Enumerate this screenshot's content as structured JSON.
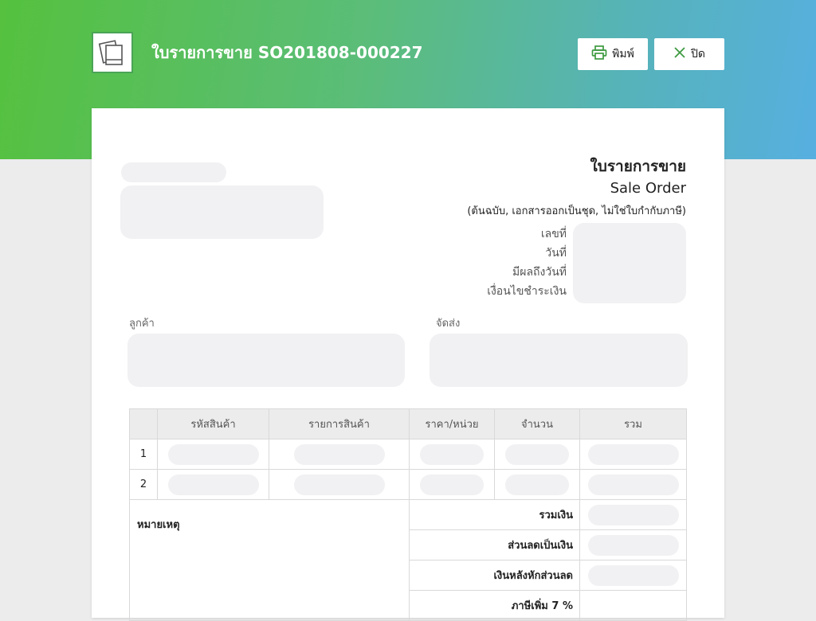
{
  "header": {
    "title": "ใบรายการขาย SO201808-000227",
    "icon": "photo-stack-icon",
    "print_label": "พิมพ์",
    "close_label": "ปิด",
    "colors": {
      "gradient_start": "#55c13e",
      "gradient_end": "#56afe0"
    }
  },
  "document": {
    "type_th": "ใบรายการขาย",
    "type_en": "Sale Order",
    "note": "(ต้นฉบับ, เอกสารออกเป็นชุด, ไม่ใช่ใบกำกับภาษี)",
    "meta_labels": [
      "เลขที่",
      "วันที่",
      "มีผลถึงวันที่",
      "เงื่อนไขชำระเงิน"
    ],
    "customer_label": "ลูกค้า",
    "shipping_label": "จัดส่ง"
  },
  "table": {
    "columns": [
      "",
      "รหัสสินค้า",
      "รายการสินค้า",
      "ราคา/หน่วย",
      "จำนวน",
      "รวม"
    ],
    "rows": [
      {
        "no": "1"
      },
      {
        "no": "2"
      }
    ],
    "remark_label": "หมายเหตุ",
    "summary_labels": [
      "รวมเงิน",
      "ส่วนลดเป็นเงิน",
      "เงินหลังหักส่วนลด",
      "ภาษีเพิ่ม 7 %"
    ]
  }
}
